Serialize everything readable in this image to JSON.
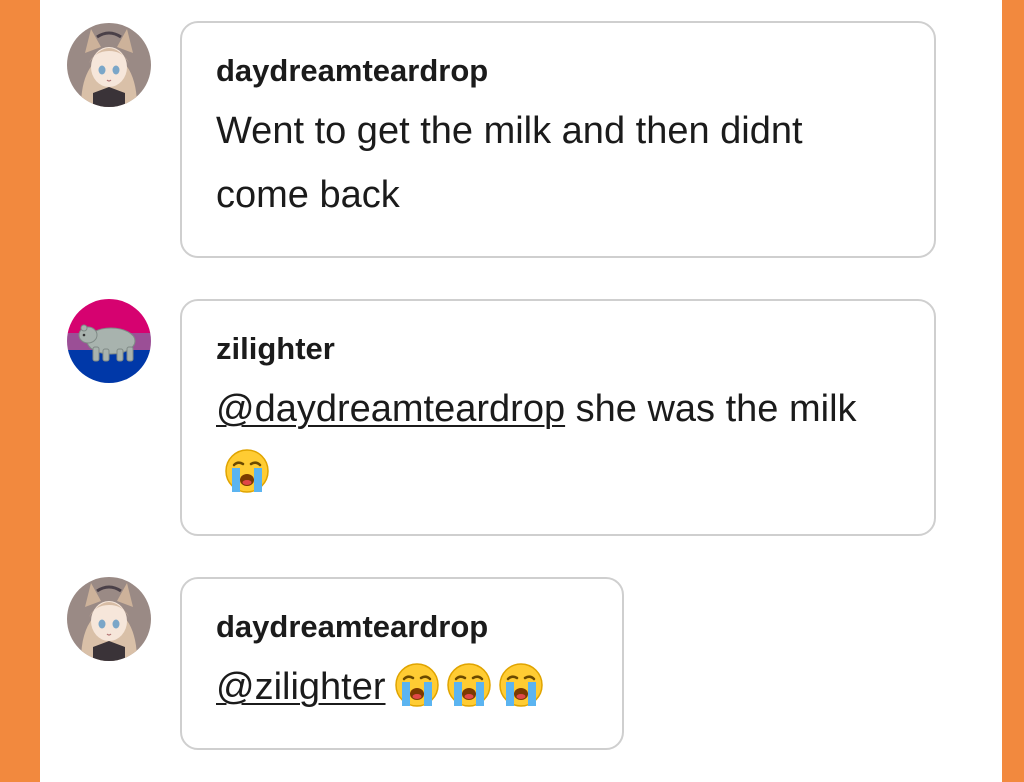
{
  "colors": {
    "side_background": "#f2893e",
    "panel": "#ffffff",
    "bubble_border": "#cfcfcf",
    "text": "#1b1b1b"
  },
  "replies": [
    {
      "avatar": "anime-girl-avatar",
      "username": "daydreamteardrop",
      "text": "Went to get the milk and then didnt come back"
    },
    {
      "avatar": "bi-flag-bear-avatar",
      "username": "zilighter",
      "mention": "@daydreamteardrop",
      "text": " she was the milk",
      "emoji": [
        "loudly-crying-face"
      ]
    },
    {
      "avatar": "anime-girl-avatar",
      "username": "daydreamteardrop",
      "mention": "@zilighter",
      "text": "",
      "emoji": [
        "loudly-crying-face",
        "loudly-crying-face",
        "loudly-crying-face"
      ]
    }
  ]
}
